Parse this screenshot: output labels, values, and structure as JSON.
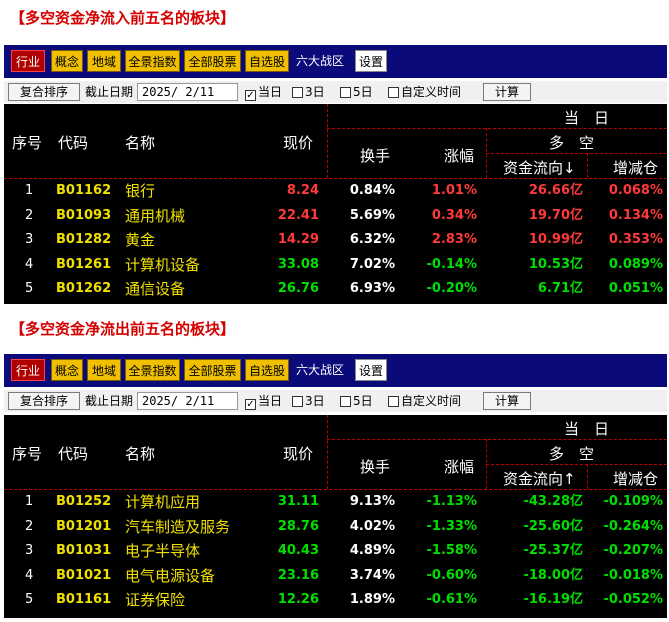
{
  "sections": [
    {
      "title": "【多空资金净流入前五名的板块】",
      "nav_tabs": [
        {
          "label": "行业",
          "style": "active"
        },
        {
          "label": "概念",
          "style": "yellow"
        },
        {
          "label": "地域",
          "style": "yellow"
        },
        {
          "label": "全景指数",
          "style": "yellow"
        },
        {
          "label": "全部股票",
          "style": "yellow"
        },
        {
          "label": "自选股",
          "style": "yellow"
        },
        {
          "label": "六大战区",
          "style": "plain"
        },
        {
          "label": "设置",
          "style": "white"
        }
      ],
      "toolbar": {
        "sort_button": "复合排序",
        "date_label": "截止日期",
        "date_value": "2025/ 2/11",
        "options": [
          {
            "label": "当日",
            "checked": true
          },
          {
            "label": "3日",
            "checked": false
          },
          {
            "label": "5日",
            "checked": false
          },
          {
            "label": "自定义时间",
            "checked": false
          }
        ],
        "calc_button": "计算"
      },
      "headers": {
        "period": "当　日",
        "group": "多　空",
        "idx": "序号",
        "code": "代码",
        "name": "名称",
        "price": "现价",
        "turnover": "换手",
        "change": "涨幅",
        "flow": "资金流向↓",
        "position": "增减仓"
      },
      "rows": [
        {
          "idx": "1",
          "code": "B01162",
          "name": "银行",
          "price": "8.24",
          "turnover": "0.84%",
          "change": "1.01%",
          "flow": "26.66亿",
          "position": "0.068%",
          "dir": "up"
        },
        {
          "idx": "2",
          "code": "B01093",
          "name": "通用机械",
          "price": "22.41",
          "turnover": "5.69%",
          "change": "0.34%",
          "flow": "19.70亿",
          "position": "0.134%",
          "dir": "up"
        },
        {
          "idx": "3",
          "code": "B01282",
          "name": "黄金",
          "price": "14.29",
          "turnover": "6.32%",
          "change": "2.83%",
          "flow": "10.99亿",
          "position": "0.353%",
          "dir": "up"
        },
        {
          "idx": "4",
          "code": "B01261",
          "name": "计算机设备",
          "price": "33.08",
          "turnover": "7.02%",
          "change": "-0.14%",
          "flow": "10.53亿",
          "position": "0.089%",
          "dir": "down"
        },
        {
          "idx": "5",
          "code": "B01262",
          "name": "通信设备",
          "price": "26.76",
          "turnover": "6.93%",
          "change": "-0.20%",
          "flow": "6.71亿",
          "position": "0.051%",
          "dir": "down"
        }
      ]
    },
    {
      "title": "【多空资金净流出前五名的板块】",
      "nav_tabs": [
        {
          "label": "行业",
          "style": "active"
        },
        {
          "label": "概念",
          "style": "yellow"
        },
        {
          "label": "地域",
          "style": "yellow"
        },
        {
          "label": "全景指数",
          "style": "yellow"
        },
        {
          "label": "全部股票",
          "style": "yellow"
        },
        {
          "label": "自选股",
          "style": "yellow"
        },
        {
          "label": "六大战区",
          "style": "plain"
        },
        {
          "label": "设置",
          "style": "white"
        }
      ],
      "toolbar": {
        "sort_button": "复合排序",
        "date_label": "截止日期",
        "date_value": "2025/ 2/11",
        "options": [
          {
            "label": "当日",
            "checked": true
          },
          {
            "label": "3日",
            "checked": false
          },
          {
            "label": "5日",
            "checked": false
          },
          {
            "label": "自定义时间",
            "checked": false
          }
        ],
        "calc_button": "计算"
      },
      "headers": {
        "period": "当　日",
        "group": "多　空",
        "idx": "序号",
        "code": "代码",
        "name": "名称",
        "price": "现价",
        "turnover": "换手",
        "change": "涨幅",
        "flow": "资金流向↑",
        "position": "增减仓"
      },
      "rows": [
        {
          "idx": "1",
          "code": "B01252",
          "name": "计算机应用",
          "price": "31.11",
          "turnover": "9.13%",
          "change": "-1.13%",
          "flow": "-43.28亿",
          "position": "-0.109%",
          "dir": "down"
        },
        {
          "idx": "2",
          "code": "B01201",
          "name": "汽车制造及服务",
          "price": "28.76",
          "turnover": "4.02%",
          "change": "-1.33%",
          "flow": "-25.60亿",
          "position": "-0.264%",
          "dir": "down"
        },
        {
          "idx": "3",
          "code": "B01031",
          "name": "电子半导体",
          "price": "40.43",
          "turnover": "4.89%",
          "change": "-1.58%",
          "flow": "-25.37亿",
          "position": "-0.207%",
          "dir": "down"
        },
        {
          "idx": "4",
          "code": "B01021",
          "name": "电气电源设备",
          "price": "23.16",
          "turnover": "3.74%",
          "change": "-0.60%",
          "flow": "-18.00亿",
          "position": "-0.018%",
          "dir": "down"
        },
        {
          "idx": "5",
          "code": "B01161",
          "name": "证券保险",
          "price": "12.26",
          "turnover": "1.89%",
          "change": "-0.61%",
          "flow": "-16.19亿",
          "position": "-0.052%",
          "dir": "down"
        }
      ]
    }
  ],
  "colors": {
    "up": "#ff3a3a",
    "down": "#00e000",
    "code": "#f0e000",
    "nav_bg": "#0a0a7a"
  }
}
